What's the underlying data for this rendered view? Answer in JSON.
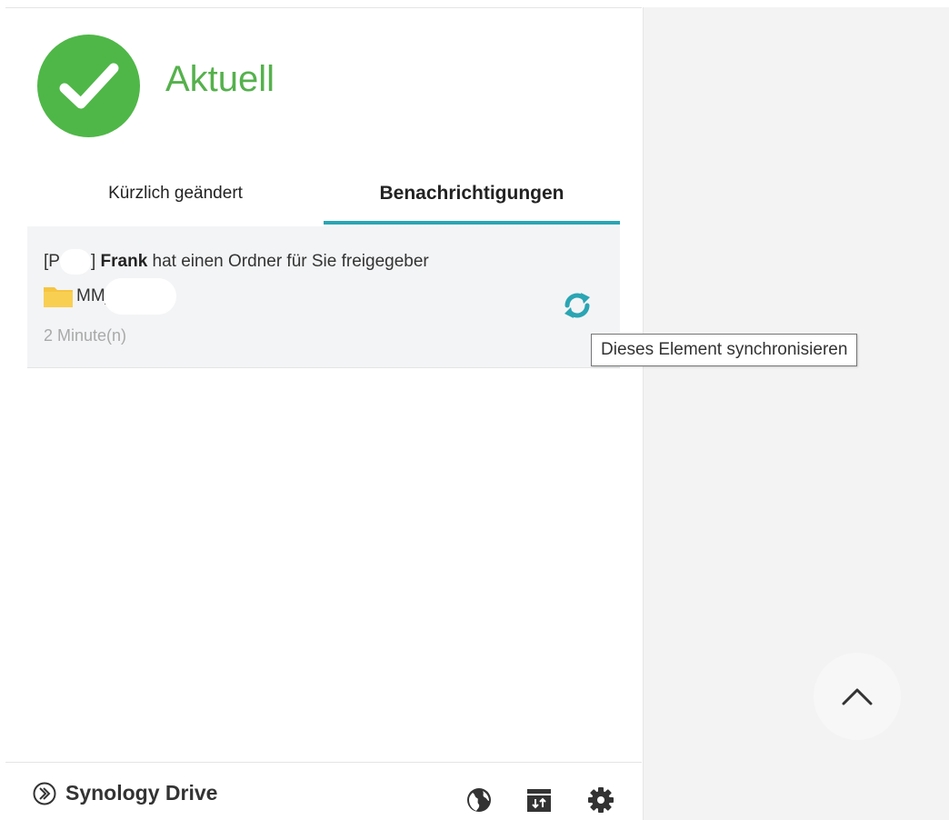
{
  "status": {
    "title": "Aktuell",
    "icon": "checkmark-icon",
    "color": "#4fb748"
  },
  "tabs": [
    {
      "label": "Kürzlich geändert",
      "active": false
    },
    {
      "label": "Benachrichtigungen",
      "active": true
    }
  ],
  "notification": {
    "prefix": "[P",
    "prefix_end": "]",
    "sender": "Frank",
    "message": "hat einen Ordner für Sie freigegeber",
    "folder_name": "MM_",
    "time": "2 Minute(n)",
    "sync_icon": "sync-icon"
  },
  "tooltip": {
    "text": "Dieses Element synchronisieren"
  },
  "footer": {
    "brand": "Synology Drive",
    "icons": [
      "globe-icon",
      "calendar-sync-icon",
      "gear-icon"
    ]
  },
  "colors": {
    "accent": "#2aa5b3",
    "success": "#4fb748",
    "folder": "#f5c542"
  }
}
